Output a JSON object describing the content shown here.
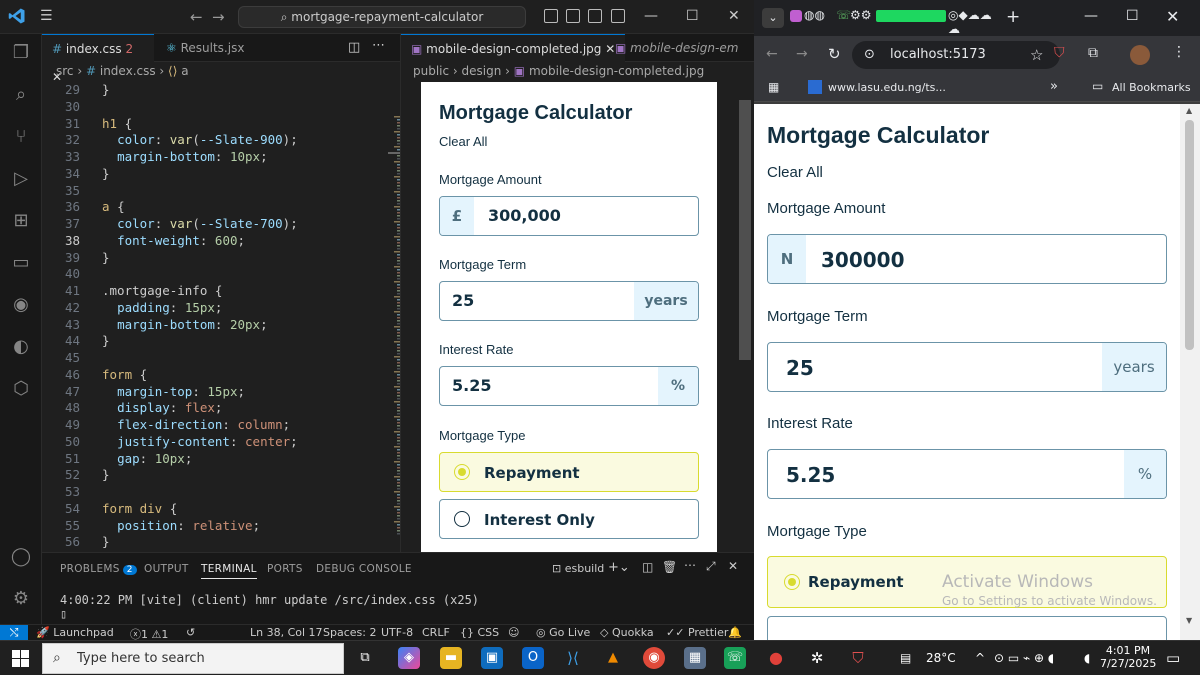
{
  "vscode": {
    "search_text": "mortgage-repayment-calculator",
    "tabs": [
      {
        "label": "index.css",
        "badge": "2",
        "active": true
      },
      {
        "label": "Results.jsx",
        "active": false
      }
    ],
    "breadcrumb": [
      "src",
      "index.css",
      "a"
    ],
    "cursor_line": 38,
    "code_lines": [
      {
        "n": 29,
        "t": "}"
      },
      {
        "n": 30,
        "t": ""
      },
      {
        "n": 31,
        "t": "h1 {"
      },
      {
        "n": 32,
        "t": "  color: var(--Slate-900);"
      },
      {
        "n": 33,
        "t": "  margin-bottom: 10px;"
      },
      {
        "n": 34,
        "t": "}"
      },
      {
        "n": 35,
        "t": ""
      },
      {
        "n": 36,
        "t": "a {"
      },
      {
        "n": 37,
        "t": "  color: var(--Slate-700);"
      },
      {
        "n": 38,
        "t": "  font-weight: 600;"
      },
      {
        "n": 39,
        "t": "}"
      },
      {
        "n": 40,
        "t": ""
      },
      {
        "n": 41,
        "t": ".mortgage-info {"
      },
      {
        "n": 42,
        "t": "  padding: 15px;"
      },
      {
        "n": 43,
        "t": "  margin-bottom: 20px;"
      },
      {
        "n": 44,
        "t": "}"
      },
      {
        "n": 45,
        "t": ""
      },
      {
        "n": 46,
        "t": "form {"
      },
      {
        "n": 47,
        "t": "  margin-top: 15px;"
      },
      {
        "n": 48,
        "t": "  display: flex;"
      },
      {
        "n": 49,
        "t": "  flex-direction: column;"
      },
      {
        "n": 50,
        "t": "  justify-content: center;"
      },
      {
        "n": 51,
        "t": "  gap: 10px;"
      },
      {
        "n": 52,
        "t": "}"
      },
      {
        "n": 53,
        "t": ""
      },
      {
        "n": 54,
        "t": "form div {"
      },
      {
        "n": 55,
        "t": "  position: relative;"
      },
      {
        "n": 56,
        "t": "}"
      }
    ],
    "image_tabs": [
      {
        "label": "mobile-design-completed.jpg",
        "active": true
      },
      {
        "label": "mobile-design-em",
        "active": false
      }
    ],
    "image_breadcrumb": [
      "public",
      "design",
      "mobile-design-completed.jpg"
    ],
    "panel_tabs": [
      {
        "label": "PROBLEMS",
        "badge": "2"
      },
      {
        "label": "OUTPUT"
      },
      {
        "label": "TERMINAL",
        "active": true
      },
      {
        "label": "PORTS"
      },
      {
        "label": "DEBUG CONSOLE"
      }
    ],
    "terminal_name": "esbuild",
    "terminal_line": "4:00:22 PM [vite] (client) hmr update /src/index.css (x25)",
    "terminal_prompt": "▯",
    "status": {
      "launchpad": "Launchpad",
      "errors": "1",
      "warnings": "1",
      "position": "Ln 38, Col 17",
      "spaces": "Spaces: 2",
      "encoding": "UTF-8",
      "eol": "CRLF",
      "lang": "CSS",
      "golive": "Go Live",
      "quokka": "Quokka",
      "prettier": "Prettier"
    }
  },
  "mock": {
    "title": "Mortgage Calculator",
    "clear": "Clear All",
    "amount_label": "Mortgage Amount",
    "amount_prefix": "£",
    "amount_value": "300,000",
    "term_label": "Mortgage Term",
    "term_value": "25",
    "term_suffix": "years",
    "rate_label": "Interest Rate",
    "rate_value": "5.25",
    "rate_suffix": "%",
    "type_label": "Mortgage Type",
    "opt1": "Repayment",
    "opt2": "Interest Only"
  },
  "chrome": {
    "url": "localhost:5173",
    "bookmark": "www.lasu.edu.ng/ts...",
    "all_bookmarks": "All Bookmarks",
    "app": {
      "title": "Mortgage Calculator",
      "clear": "Clear All",
      "amount_label": "Mortgage Amount",
      "amount_prefix": "N",
      "amount_value": "300000",
      "term_label": "Mortgage Term",
      "term_value": "25",
      "term_suffix": "years",
      "rate_label": "Interest Rate",
      "rate_value": "5.25",
      "rate_suffix": "%",
      "type_label": "Mortgage Type",
      "opt1": "Repayment"
    },
    "watermark_title": "Activate Windows",
    "watermark_sub": "Go to Settings to activate Windows."
  },
  "taskbar": {
    "search_placeholder": "Type here to search",
    "weather": "28°C",
    "time": "4:01 PM",
    "date": "7/27/2025"
  },
  "colors": {
    "accent": "#0078d4",
    "lime": "#d8db2f",
    "slate900": "#133041"
  }
}
